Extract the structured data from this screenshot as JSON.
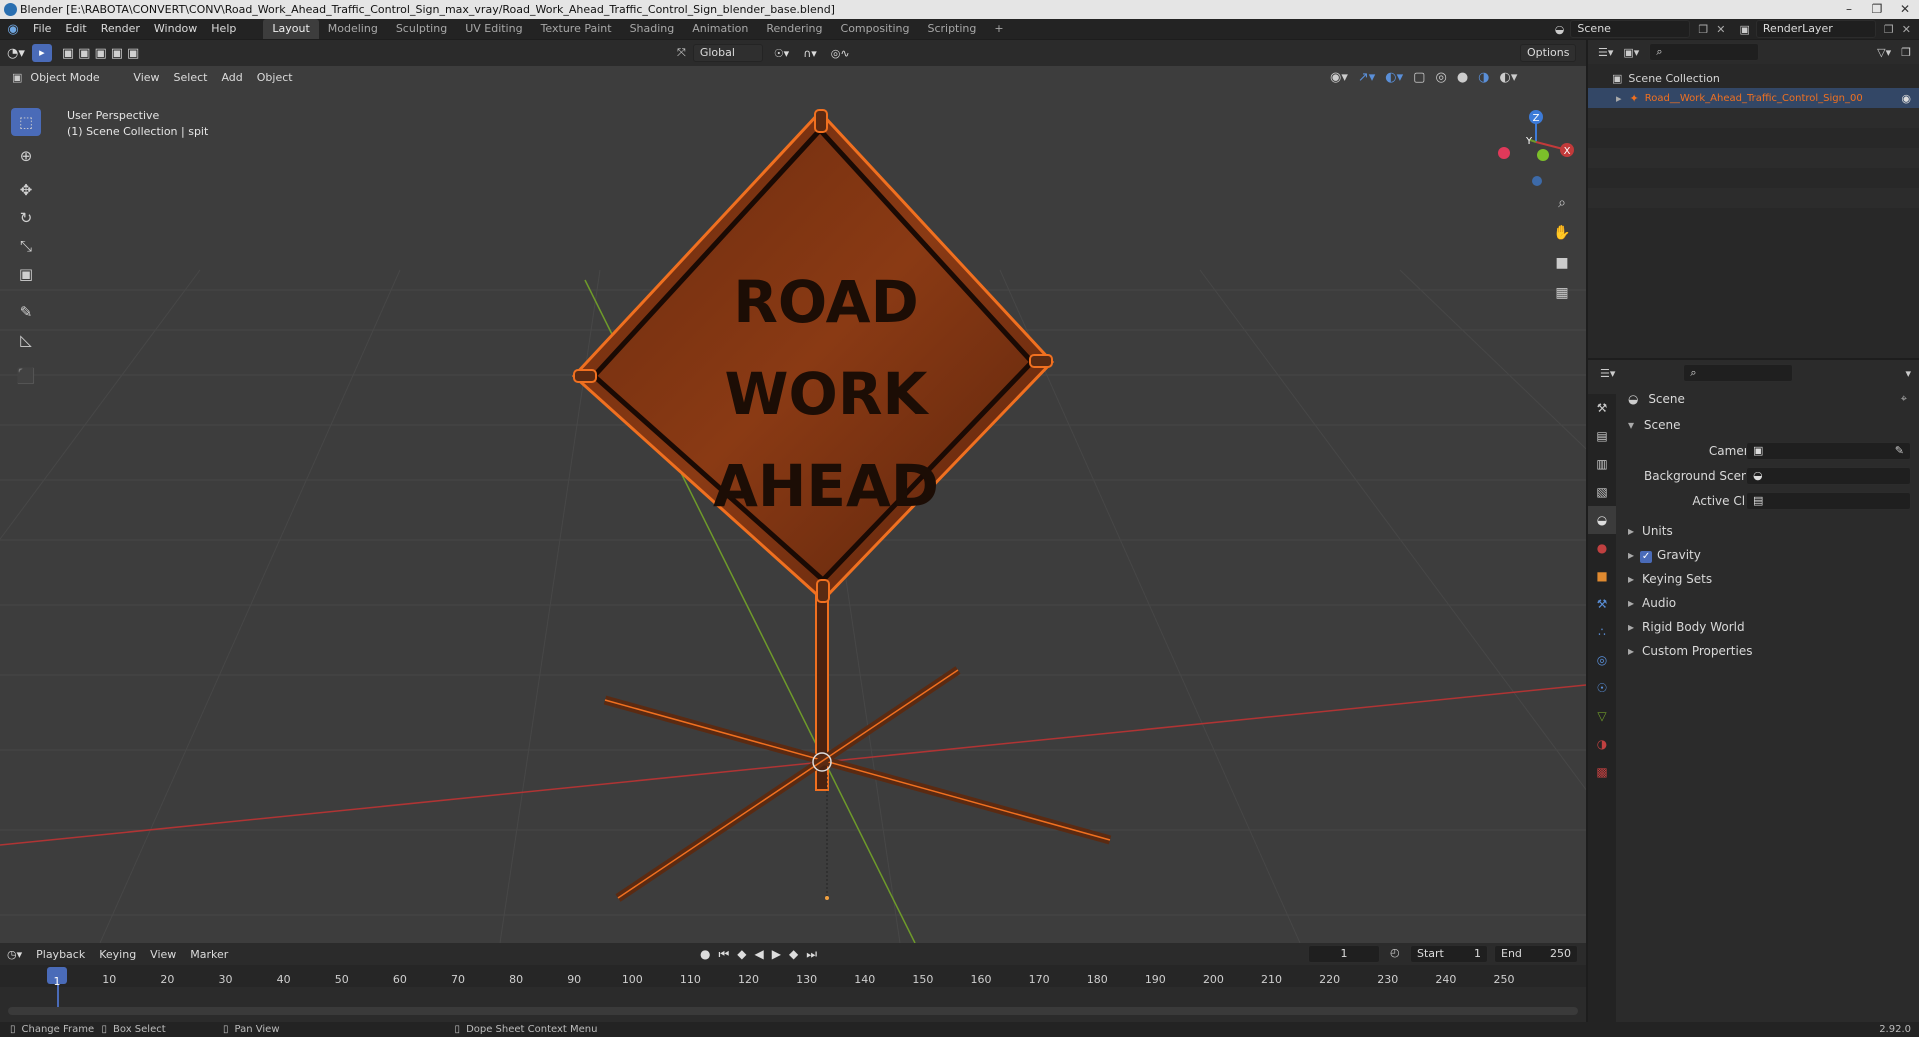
{
  "title_bar": {
    "title": "Blender [E:\\RABOTA\\CONVERT\\CONV\\Road_Work_Ahead_Traffic_Control_Sign_max_vray/Road_Work_Ahead_Traffic_Control_Sign_blender_base.blend]"
  },
  "menu": [
    "File",
    "Edit",
    "Render",
    "Window",
    "Help"
  ],
  "workspaces": [
    "Layout",
    "Modeling",
    "Sculpting",
    "UV Editing",
    "Texture Paint",
    "Shading",
    "Animation",
    "Rendering",
    "Compositing",
    "Scripting"
  ],
  "scene_field": "Scene",
  "renderlayer_field": "RenderLayer",
  "viewport": {
    "transform_orientation": "Global",
    "options_label": "Options",
    "mode": "Object Mode",
    "menus": [
      "View",
      "Select",
      "Add",
      "Object"
    ],
    "overlay_line1": "User Perspective",
    "overlay_line2": "(1) Scene Collection | spit",
    "sign_text": [
      "ROAD",
      "WORK",
      "AHEAD"
    ],
    "gizmo_axes": [
      "Z",
      "Y",
      "X"
    ]
  },
  "outliner": {
    "root": "Scene Collection",
    "object": "Road__Work_Ahead_Traffic_Control_Sign_00"
  },
  "properties": {
    "header": "Scene",
    "panel": "Scene",
    "camera_label": "Camera",
    "background_scene_label": "Background Scene",
    "active_clip_label": "Active Clip",
    "subpanels": [
      "Units",
      "Gravity",
      "Keying Sets",
      "Audio",
      "Rigid Body World",
      "Custom Properties"
    ]
  },
  "timeline": {
    "menus": [
      "Playback",
      "Keying",
      "View",
      "Marker"
    ],
    "current_frame": "1",
    "start_label": "Start",
    "start_value": "1",
    "end_label": "End",
    "end_value": "250",
    "ticks": [
      "1",
      "10",
      "20",
      "30",
      "40",
      "50",
      "60",
      "70",
      "80",
      "90",
      "100",
      "110",
      "120",
      "130",
      "140",
      "150",
      "160",
      "170",
      "180",
      "190",
      "200",
      "210",
      "220",
      "230",
      "240",
      "250"
    ]
  },
  "status": {
    "items": [
      "Change Frame",
      "Box Select",
      "Pan View",
      "Dope Sheet Context Menu"
    ],
    "version": "2.92.0"
  },
  "colors": {
    "selection_orange": "#f07020",
    "active_blue": "#4a6bb8",
    "axis_red": "#c23a3a",
    "axis_green": "#6e9a2a"
  }
}
